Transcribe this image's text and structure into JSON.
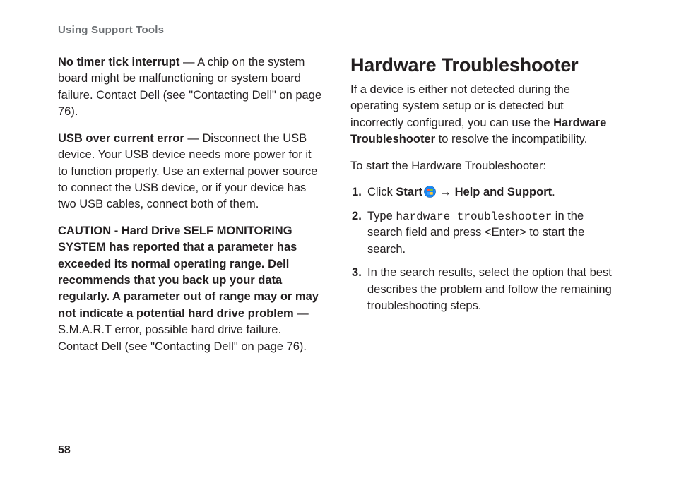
{
  "running_head": "Using Support Tools",
  "page_number": "58",
  "left": {
    "p1_b": "No timer tick interrupt",
    "p1_rest": " — A chip on the system board might be malfunctioning or system board failure. Contact Dell (see \"Contacting Dell\" on page 76).",
    "p2_b": "USB over current error",
    "p2_rest": " — Disconnect the USB device. Your USB device needs more power for it to function properly. Use an external power source to connect the USB device, or if your device has two USB cables, connect both of them.",
    "p3_b": "CAUTION - Hard Drive SELF MONITORING SYSTEM has reported that a parameter has exceeded its normal operating range. Dell recommends that you back up your data regularly. A parameter out of range may or may not indicate a potential hard drive problem",
    "p3_rest": " — S.M.A.R.T error, possible hard drive failure. Contact Dell (see \"Contacting Dell\" on page 76)."
  },
  "right": {
    "heading": "Hardware Troubleshooter",
    "intro_pre": "If a device is either not detected during the operating system setup or is detected but incorrectly configured, you can use the ",
    "intro_bold": "Hardware Troubleshooter",
    "intro_post": " to resolve the incompatibility.",
    "start_line": "To start the Hardware Troubleshooter:",
    "step1_pre": "Click ",
    "step1_b1": "Start",
    "step1_arrow": " → ",
    "step1_b2": "Help and Support",
    "step1_post": ".",
    "step2_pre": "Type ",
    "step2_mono": "hardware troubleshooter",
    "step2_post": " in the search field and press <Enter> to start the search.",
    "step3": "In the search results, select the option that best describes the problem and follow the remaining troubleshooting steps."
  }
}
